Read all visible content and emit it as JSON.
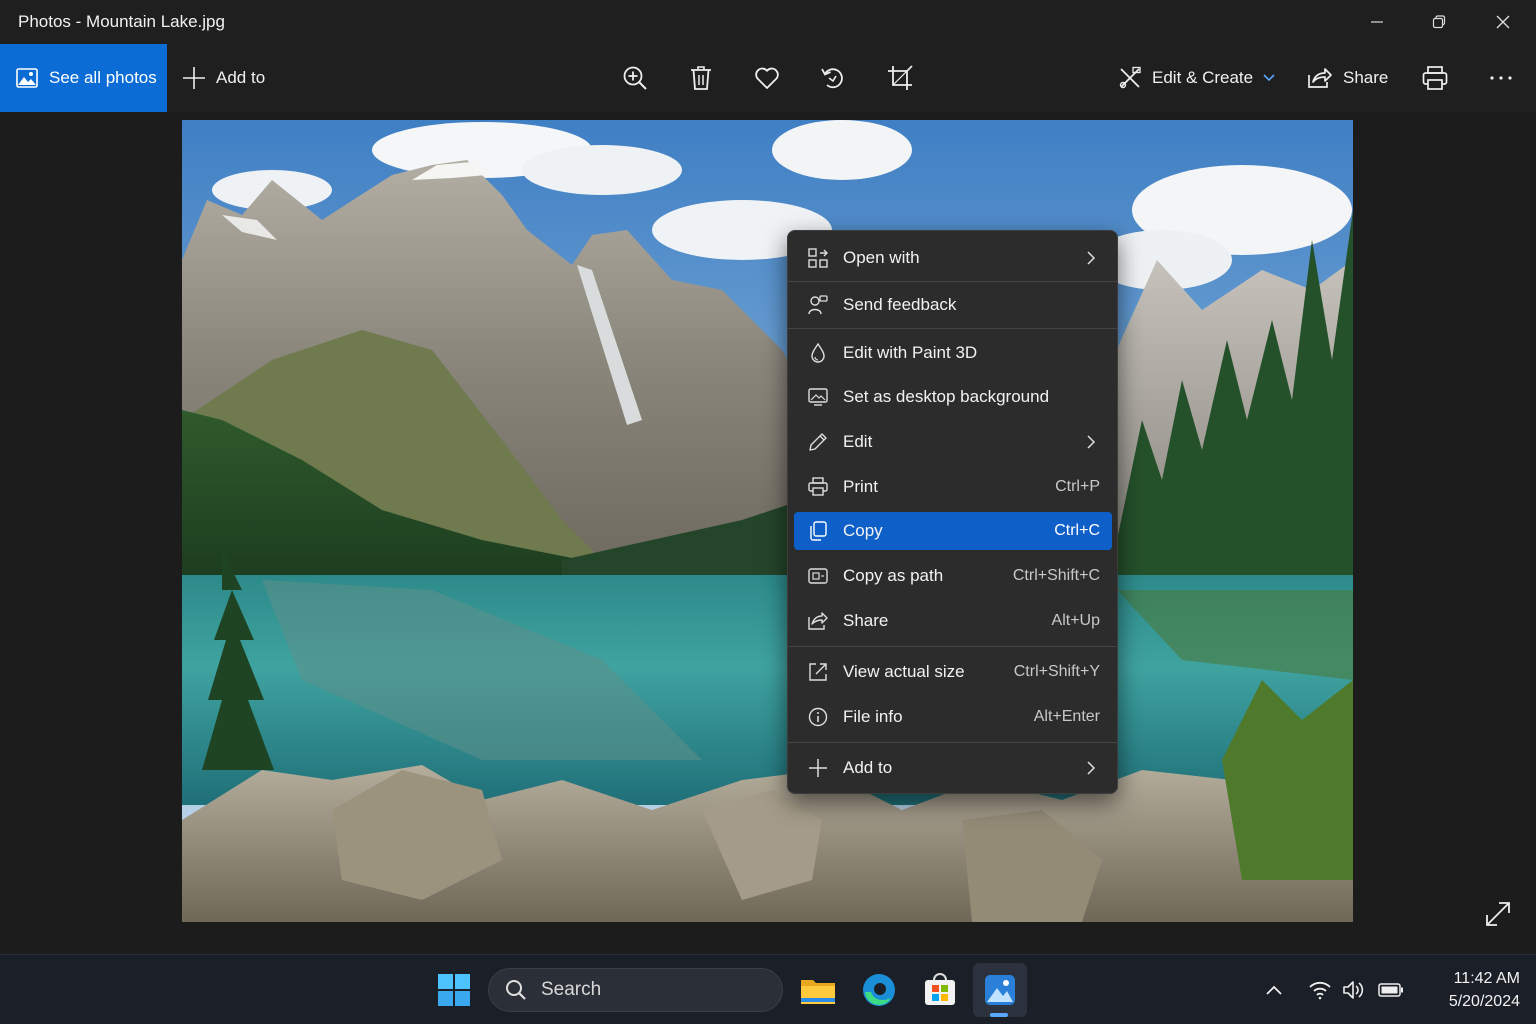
{
  "window": {
    "title": "Photos - Mountain Lake.jpg",
    "controls": [
      "minimize",
      "restore",
      "close"
    ]
  },
  "toolbar": {
    "see_all_label": "See all photos",
    "add_to_label": "Add to",
    "icons": [
      "zoom-in-icon",
      "delete-icon",
      "favorite-icon",
      "rotate-icon",
      "crop-icon"
    ],
    "edit_create_label": "Edit & Create",
    "share_label": "Share",
    "print_icon": "print-icon",
    "more_icon": "more-icon"
  },
  "photo": {
    "file_name": "Mountain Lake.jpg"
  },
  "context_menu": {
    "items": [
      {
        "label": "Open with",
        "shortcut": "",
        "submenu": true,
        "icon": "open-with-icon"
      },
      {
        "label": "Send feedback",
        "shortcut": "",
        "submenu": false,
        "icon": "feedback-icon"
      },
      {
        "label": "Edit with Paint 3D",
        "shortcut": "",
        "submenu": false,
        "icon": "paint3d-icon"
      },
      {
        "label": "Set as desktop background",
        "shortcut": "",
        "submenu": false,
        "icon": "desktop-background-icon"
      },
      {
        "label": "Edit",
        "shortcut": "",
        "submenu": true,
        "icon": "pencil-icon"
      },
      {
        "label": "Print",
        "shortcut": "Ctrl+P",
        "submenu": false,
        "icon": "printer-icon"
      },
      {
        "label": "Copy",
        "shortcut": "Ctrl+C",
        "submenu": false,
        "icon": "copy-icon",
        "highlighted": true
      },
      {
        "label": "Copy as path",
        "shortcut": "Ctrl+Shift+C",
        "submenu": false,
        "icon": "copy-path-icon"
      },
      {
        "label": "Share",
        "shortcut": "Alt+Up",
        "submenu": false,
        "icon": "share-icon"
      },
      {
        "label": "View actual size",
        "shortcut": "Ctrl+Shift+Y",
        "submenu": false,
        "icon": "actual-size-icon"
      },
      {
        "label": "File info",
        "shortcut": "Alt+Enter",
        "submenu": false,
        "icon": "info-icon"
      },
      {
        "label": "Add to",
        "shortcut": "",
        "submenu": true,
        "icon": "plus-icon"
      }
    ]
  },
  "taskbar": {
    "search_placeholder": "Search",
    "pinned": [
      "start-icon",
      "file-explorer-icon",
      "edge-icon",
      "store-icon",
      "photos-icon"
    ],
    "active_app": "photos-icon",
    "tray": [
      "chevron-up-icon",
      "wifi-icon",
      "volume-icon",
      "battery-icon"
    ],
    "time": "11:42 AM",
    "date": "5/20/2024"
  },
  "colors": {
    "accent": "#0b6cd6",
    "menu_highlight": "#0f5fc8",
    "chrome_bg": "#1f1f1f",
    "taskbar_bg": "#1b1f27"
  }
}
